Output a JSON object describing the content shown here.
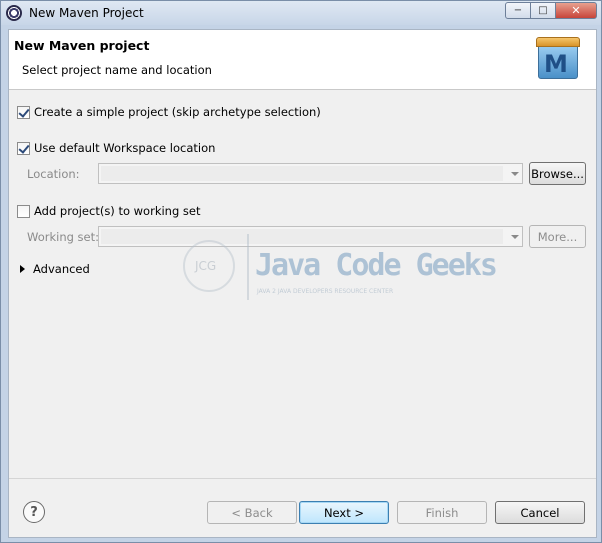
{
  "window": {
    "title": "New Maven Project",
    "controls": {
      "minimize": "−",
      "maximize": "□",
      "close": "✕"
    }
  },
  "header": {
    "title": "New Maven project",
    "description": "Select project name and location",
    "logo_letter": "M"
  },
  "options": {
    "simple_project": {
      "label": "Create a simple project (skip archetype selection)",
      "checked": true
    },
    "default_workspace": {
      "label": "Use default Workspace location",
      "checked": true
    },
    "location": {
      "label": "Location:",
      "value": "",
      "browse_label": "Browse..."
    },
    "working_set_option": {
      "label": "Add project(s) to working set",
      "checked": false
    },
    "working_set": {
      "label": "Working set:",
      "value": "",
      "more_label": "More..."
    },
    "advanced_label": "Advanced"
  },
  "watermark": {
    "badge": "JCG",
    "title": "Java Code Geeks",
    "subtitle": "JAVA 2 JAVA DEVELOPERS RESOURCE CENTER"
  },
  "footer": {
    "help_symbol": "?",
    "back_label": "< Back",
    "next_label": "Next >",
    "finish_label": "Finish",
    "cancel_label": "Cancel"
  }
}
